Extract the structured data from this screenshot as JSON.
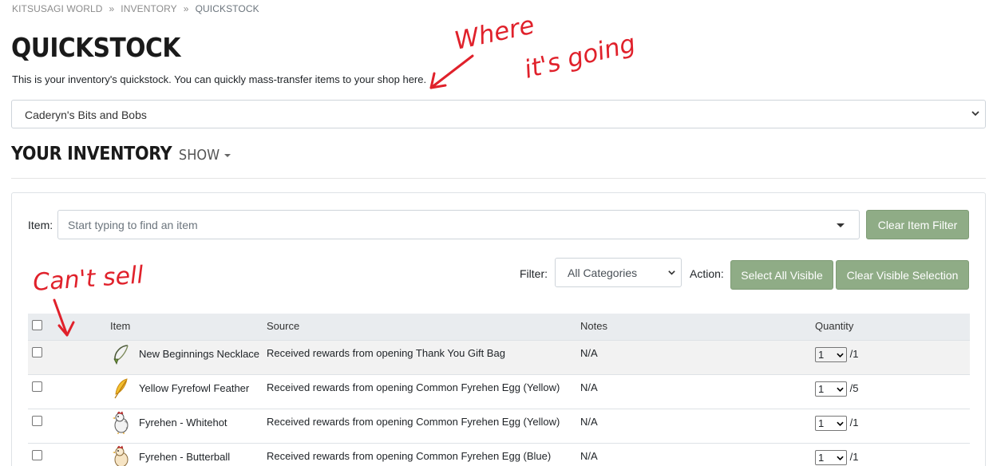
{
  "breadcrumb": {
    "home": "KITSUSAGI WORLD",
    "section": "INVENTORY",
    "current": "QUICKSTOCK",
    "sep": "»"
  },
  "page": {
    "title": "QUICKSTOCK",
    "intro": "This is your inventory's quickstock. You can quickly mass-transfer items to your shop here."
  },
  "shop_select": {
    "value": "Caderyn's Bits and Bobs"
  },
  "inventory": {
    "title": "YOUR INVENTORY",
    "show": "SHOW"
  },
  "filter_bar": {
    "item_label": "Item:",
    "item_placeholder": "Start typing to find an item",
    "clear_item_filter": "Clear Item Filter",
    "filter_label": "Filter:",
    "category_value": "All Categories",
    "action_label": "Action:",
    "select_all": "Select All Visible",
    "clear_selection": "Clear Visible Selection"
  },
  "table": {
    "headers": {
      "item": "Item",
      "source": "Source",
      "notes": "Notes",
      "quantity": "Quantity"
    },
    "rows": [
      {
        "name": "New Beginnings Necklace",
        "icon": "necklace-icon",
        "source": "Received rewards from opening Thank You Gift Bag",
        "notes": "N/A",
        "qty": "1",
        "max": "/1"
      },
      {
        "name": "Yellow Fyrefowl Feather",
        "icon": "feather-icon",
        "source": "Received rewards from opening Common Fyrehen Egg (Yellow)",
        "notes": "N/A",
        "qty": "1",
        "max": "/5"
      },
      {
        "name": "Fyrehen - Whitehot",
        "icon": "chicken-icon",
        "source": "Received rewards from opening Common Fyrehen Egg (Yellow)",
        "notes": "N/A",
        "qty": "1",
        "max": "/1"
      },
      {
        "name": "Fyrehen - Butterball",
        "icon": "chicken-icon",
        "source": "Received rewards from opening Common Fyrehen Egg (Blue)",
        "notes": "N/A",
        "qty": "1",
        "max": "/1"
      }
    ]
  },
  "annotations": {
    "where": "Where",
    "its_going": "it's going",
    "cant_sell": "Can't sell",
    "color": "#e0212b"
  },
  "colors": {
    "accent_green": "#8fac86",
    "annotation_red": "#e0212b"
  }
}
